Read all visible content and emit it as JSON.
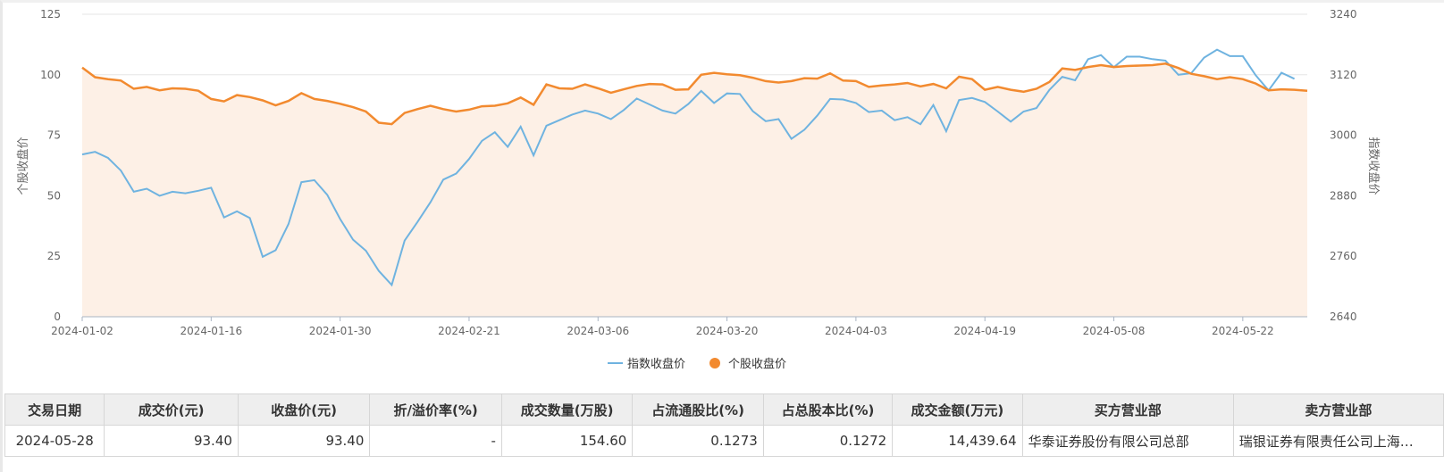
{
  "colors": {
    "index_line": "#6fb3e0",
    "stock_line": "#f28a2f",
    "stock_area": "#fdf0e6",
    "grid": "#e6e6e6",
    "axis_text": "#666666"
  },
  "legend": {
    "index_label": "指数收盘价",
    "stock_label": "个股收盘价"
  },
  "chart_data": {
    "type": "line",
    "title": "",
    "left_axis_label": "个股收盘价",
    "right_axis_label": "指数收盘价",
    "left_ylim": [
      0,
      125
    ],
    "left_ticks": [
      0,
      25,
      50,
      75,
      100,
      125
    ],
    "right_ylim": [
      2640,
      3240
    ],
    "right_ticks": [
      2640,
      2760,
      2880,
      3000,
      3120,
      3240
    ],
    "x_ticks": [
      "2024-01-02",
      "2024-01-16",
      "2024-01-30",
      "2024-02-21",
      "2024-03-06",
      "2024-03-20",
      "2024-04-03",
      "2024-04-19",
      "2024-05-08",
      "2024-05-22"
    ],
    "grid": true,
    "legend_position": "bottom-center",
    "x_count": 96,
    "series": [
      {
        "name": "个股收盘价",
        "axis": "left",
        "area": true,
        "values": [
          103.0,
          99.0,
          98.2,
          97.6,
          94.2,
          95.0,
          93.6,
          94.4,
          94.2,
          93.4,
          90.0,
          89.0,
          91.6,
          90.8,
          89.4,
          87.4,
          89.2,
          92.4,
          90.0,
          89.2,
          88.0,
          86.6,
          84.8,
          80.2,
          79.6,
          84.2,
          85.8,
          87.2,
          85.8,
          84.8,
          85.6,
          87.0,
          87.2,
          88.2,
          90.6,
          87.6,
          96.0,
          94.4,
          94.2,
          96.0,
          94.4,
          92.6,
          94.0,
          95.4,
          96.2,
          96.0,
          93.8,
          94.0,
          100.0,
          100.8,
          100.2,
          99.8,
          98.8,
          97.4,
          96.8,
          97.4,
          98.6,
          98.4,
          100.6,
          97.6,
          97.4,
          95.0,
          95.6,
          96.0,
          96.6,
          95.2,
          96.2,
          94.4,
          99.2,
          98.2,
          93.8,
          95.0,
          93.8,
          93.0,
          94.2,
          97.0,
          102.6,
          102.0,
          103.2,
          104.0,
          103.2,
          103.6,
          103.8,
          104.0,
          104.6,
          102.8,
          100.4,
          99.4,
          98.2,
          99.0,
          98.2,
          96.4,
          93.6,
          94.0,
          93.8,
          93.4
        ]
      },
      {
        "name": "指数收盘价",
        "axis": "right",
        "area": false,
        "values": [
          2962,
          2967,
          2955,
          2930,
          2888,
          2894,
          2880,
          2888,
          2885,
          2890,
          2896,
          2837,
          2849,
          2836,
          2759,
          2772,
          2824,
          2907,
          2911,
          2882,
          2834,
          2793,
          2771,
          2731,
          2703,
          2791,
          2828,
          2867,
          2912,
          2924,
          2953,
          2989,
          3006,
          2977,
          3017,
          2960,
          3019,
          3030,
          3041,
          3049,
          3043,
          3032,
          3050,
          3073,
          3061,
          3049,
          3043,
          3062,
          3088,
          3064,
          3083,
          3082,
          3048,
          3028,
          3032,
          2993,
          3011,
          3039,
          3072,
          3071,
          3064,
          3046,
          3049,
          3030,
          3036,
          3022,
          3060,
          3008,
          3070,
          3074,
          3066,
          3047,
          3027,
          3047,
          3054,
          3090,
          3116,
          3109,
          3151,
          3159,
          3135,
          3156,
          3156,
          3151,
          3148,
          3120,
          3123,
          3154,
          3170,
          3157,
          3157,
          3119,
          3089,
          3124,
          3112
        ]
      }
    ]
  },
  "table": {
    "headers": [
      "交易日期",
      "成交价(元)",
      "收盘价(元)",
      "折/溢价率(%)",
      "成交数量(万股)",
      "占流通股比(%)",
      "占总股本比(%)",
      "成交金额(万元)",
      "买方营业部",
      "卖方营业部"
    ],
    "rows": [
      [
        "2024-05-28",
        "93.40",
        "93.40",
        "-",
        "154.60",
        "0.1273",
        "0.1272",
        "14,439.64",
        "华泰证券股份有限公司总部",
        "瑞银证券有限责任公司上海…"
      ]
    ]
  }
}
